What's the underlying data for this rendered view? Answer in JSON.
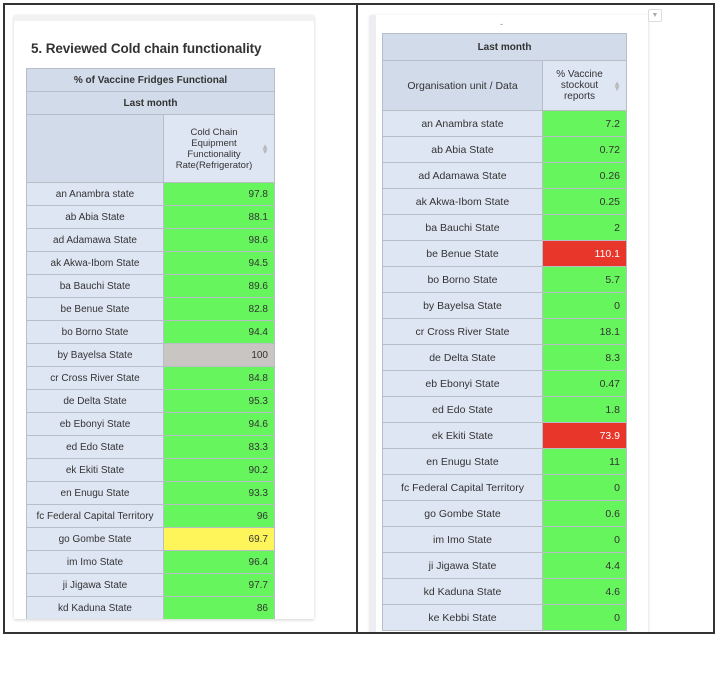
{
  "left_panel": {
    "title": "5. Reviewed Cold chain functionality",
    "table": {
      "header_row_1": "% of Vaccine Fridges Functional",
      "header_row_2": "Last month",
      "corner_label": "",
      "column_header": "Cold Chain Equipment Functionality Rate(Refrigerator)",
      "rows": [
        {
          "unit": "an Anambra state",
          "value": "97.8",
          "color": "#66f55c"
        },
        {
          "unit": "ab Abia State",
          "value": "88.1",
          "color": "#66f55c"
        },
        {
          "unit": "ad Adamawa State",
          "value": "98.6",
          "color": "#66f55c"
        },
        {
          "unit": "ak Akwa-Ibom State",
          "value": "94.5",
          "color": "#66f55c"
        },
        {
          "unit": "ba Bauchi State",
          "value": "89.6",
          "color": "#66f55c"
        },
        {
          "unit": "be Benue State",
          "value": "82.8",
          "color": "#66f55c"
        },
        {
          "unit": "bo Borno State",
          "value": "94.4",
          "color": "#66f55c"
        },
        {
          "unit": "by Bayelsa State",
          "value": "100",
          "color": "#c9c5c3"
        },
        {
          "unit": "cr Cross River State",
          "value": "84.8",
          "color": "#66f55c"
        },
        {
          "unit": "de Delta State",
          "value": "95.3",
          "color": "#66f55c"
        },
        {
          "unit": "eb Ebonyi State",
          "value": "94.6",
          "color": "#66f55c"
        },
        {
          "unit": "ed Edo State",
          "value": "83.3",
          "color": "#66f55c"
        },
        {
          "unit": "ek Ekiti State",
          "value": "90.2",
          "color": "#66f55c"
        },
        {
          "unit": "en Enugu State",
          "value": "93.3",
          "color": "#66f55c"
        },
        {
          "unit": "fc Federal Capital Territory",
          "value": "96",
          "color": "#66f55c"
        },
        {
          "unit": "go Gombe State",
          "value": "69.7",
          "color": "#fdf55a"
        },
        {
          "unit": "im Imo State",
          "value": "96.4",
          "color": "#66f55c"
        },
        {
          "unit": "ji Jigawa State",
          "value": "97.7",
          "color": "#66f55c"
        },
        {
          "unit": "kd Kaduna State",
          "value": "86",
          "color": "#66f55c"
        }
      ]
    }
  },
  "right_panel": {
    "subtitle": "-",
    "table": {
      "header_row_1": "Last month",
      "row_header_label": "Organisation unit / Data",
      "column_header": "% Vaccine stockout reports",
      "rows": [
        {
          "unit": "an Anambra state",
          "value": "7.2",
          "color": "#66f55c",
          "text_color": "#333333"
        },
        {
          "unit": "ab Abia State",
          "value": "0.72",
          "color": "#66f55c",
          "text_color": "#333333"
        },
        {
          "unit": "ad Adamawa State",
          "value": "0.26",
          "color": "#66f55c",
          "text_color": "#333333"
        },
        {
          "unit": "ak Akwa-Ibom State",
          "value": "0.25",
          "color": "#66f55c",
          "text_color": "#333333"
        },
        {
          "unit": "ba Bauchi State",
          "value": "2",
          "color": "#66f55c",
          "text_color": "#333333"
        },
        {
          "unit": "be Benue State",
          "value": "110.1",
          "color": "#e8362a",
          "text_color": "#ffffff"
        },
        {
          "unit": "bo Borno State",
          "value": "5.7",
          "color": "#66f55c",
          "text_color": "#333333"
        },
        {
          "unit": "by Bayelsa State",
          "value": "0",
          "color": "#66f55c",
          "text_color": "#333333"
        },
        {
          "unit": "cr Cross River State",
          "value": "18.1",
          "color": "#66f55c",
          "text_color": "#333333"
        },
        {
          "unit": "de Delta State",
          "value": "8.3",
          "color": "#66f55c",
          "text_color": "#333333"
        },
        {
          "unit": "eb Ebonyi State",
          "value": "0.47",
          "color": "#66f55c",
          "text_color": "#333333"
        },
        {
          "unit": "ed Edo State",
          "value": "1.8",
          "color": "#66f55c",
          "text_color": "#333333"
        },
        {
          "unit": "ek Ekiti State",
          "value": "73.9",
          "color": "#e8362a",
          "text_color": "#ffffff"
        },
        {
          "unit": "en Enugu State",
          "value": "11",
          "color": "#66f55c",
          "text_color": "#333333"
        },
        {
          "unit": "fc Federal Capital Territory",
          "value": "0",
          "color": "#66f55c",
          "text_color": "#333333"
        },
        {
          "unit": "go Gombe State",
          "value": "0.6",
          "color": "#66f55c",
          "text_color": "#333333"
        },
        {
          "unit": "im Imo State",
          "value": "0",
          "color": "#66f55c",
          "text_color": "#333333"
        },
        {
          "unit": "ji Jigawa State",
          "value": "4.4",
          "color": "#66f55c",
          "text_color": "#333333"
        },
        {
          "unit": "kd Kaduna State",
          "value": "4.6",
          "color": "#66f55c",
          "text_color": "#333333"
        },
        {
          "unit": "ke Kebbi State",
          "value": "0",
          "color": "#66f55c",
          "text_color": "#333333"
        }
      ]
    },
    "menu_icon": "dropdown-arrow-icon"
  },
  "colors": {
    "header_bg": "#d2dbea",
    "row_header_bg": "#dfe6f3",
    "good": "#66f55c",
    "warning": "#fdf55a",
    "bad": "#e8362a",
    "no_data": "#c9c5c3",
    "clipped_caption_text": "#e33333"
  }
}
